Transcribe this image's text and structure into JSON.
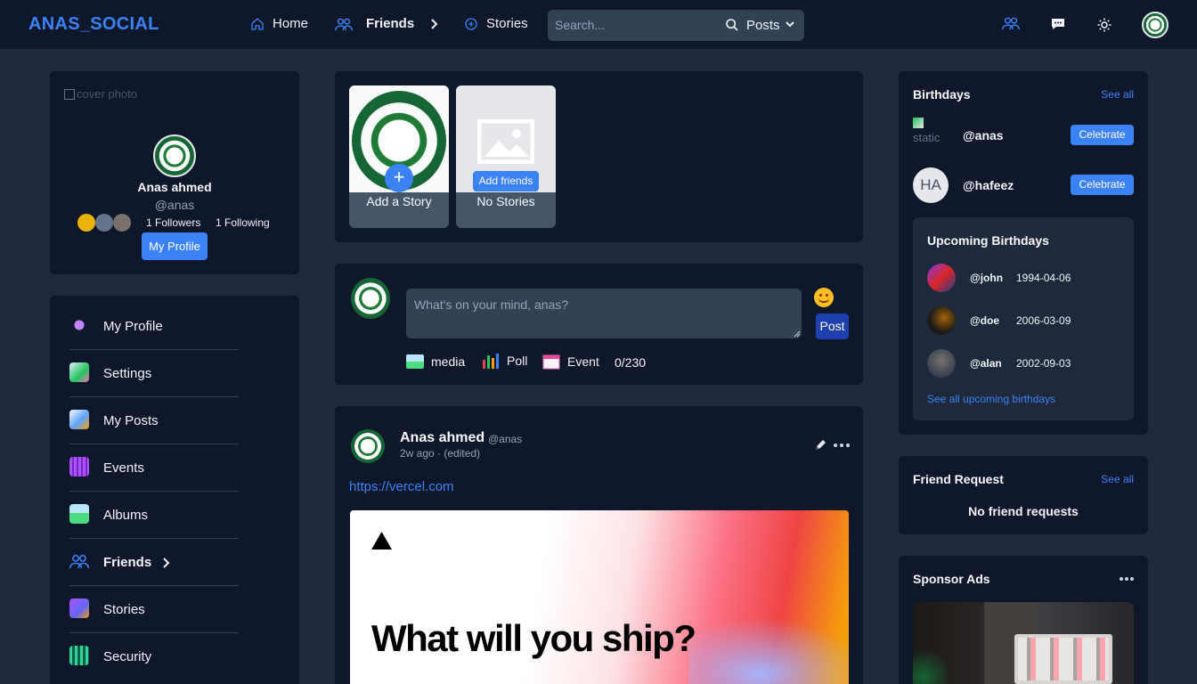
{
  "brand": "ANAS_SOCIAL",
  "nav": {
    "home": "Home",
    "friends": "Friends",
    "stories": "Stories"
  },
  "search": {
    "placeholder": "Search...",
    "filter_value": "Posts"
  },
  "profile_card": {
    "cover_alt": "cover photo",
    "name": "Anas ahmed",
    "handle": "@anas",
    "followers": "1 Followers",
    "following": "1 Following",
    "button": "My Profile"
  },
  "sidebar": {
    "items": [
      {
        "label": "My Profile",
        "icon": "alien-icon"
      },
      {
        "label": "Settings",
        "icon": "settings-image-icon"
      },
      {
        "label": "My Posts",
        "icon": "posts-icon"
      },
      {
        "label": "Events",
        "icon": "calendar-icon"
      },
      {
        "label": "Albums",
        "icon": "album-icon"
      },
      {
        "label": "Friends",
        "icon": "friends-icon"
      },
      {
        "label": "Stories",
        "icon": "stories-icon"
      },
      {
        "label": "Security",
        "icon": "security-icon"
      }
    ]
  },
  "stories": {
    "add_label": "Add a Story",
    "add_friends": "Add friends",
    "no_stories": "No Stories"
  },
  "composer": {
    "placeholder": "What's on your mind, anas?",
    "post_button": "Post",
    "media": "media",
    "poll": "Poll",
    "event": "Event",
    "counter": "0/230"
  },
  "post": {
    "author": "Anas ahmed",
    "handle": "@anas",
    "meta": "2w ago · (edited)",
    "link": "https://vercel.com",
    "image_headline": "What will you ship?"
  },
  "birthdays": {
    "title": "Birthdays",
    "see_all": "See all",
    "today": [
      {
        "handle": "@anas",
        "avatar_text": "static",
        "button": "Celebrate"
      },
      {
        "handle": "@hafeez",
        "avatar_text": "HA",
        "button": "Celebrate"
      }
    ],
    "upcoming_title": "Upcoming Birthdays",
    "upcoming": [
      {
        "handle": "@john",
        "date": "1994-04-06"
      },
      {
        "handle": "@doe",
        "date": "2006-03-09"
      },
      {
        "handle": "@alan",
        "date": "2002-09-03"
      }
    ],
    "see_all_upcoming": "See all upcoming birthdays"
  },
  "friend_request": {
    "title": "Friend Request",
    "see_all": "See all",
    "empty": "No friend requests"
  },
  "sponsor": {
    "title": "Sponsor Ads"
  },
  "colors": {
    "accent": "#3b82f6",
    "background": "#1e293b",
    "card": "#0f172a",
    "input": "#334155"
  }
}
